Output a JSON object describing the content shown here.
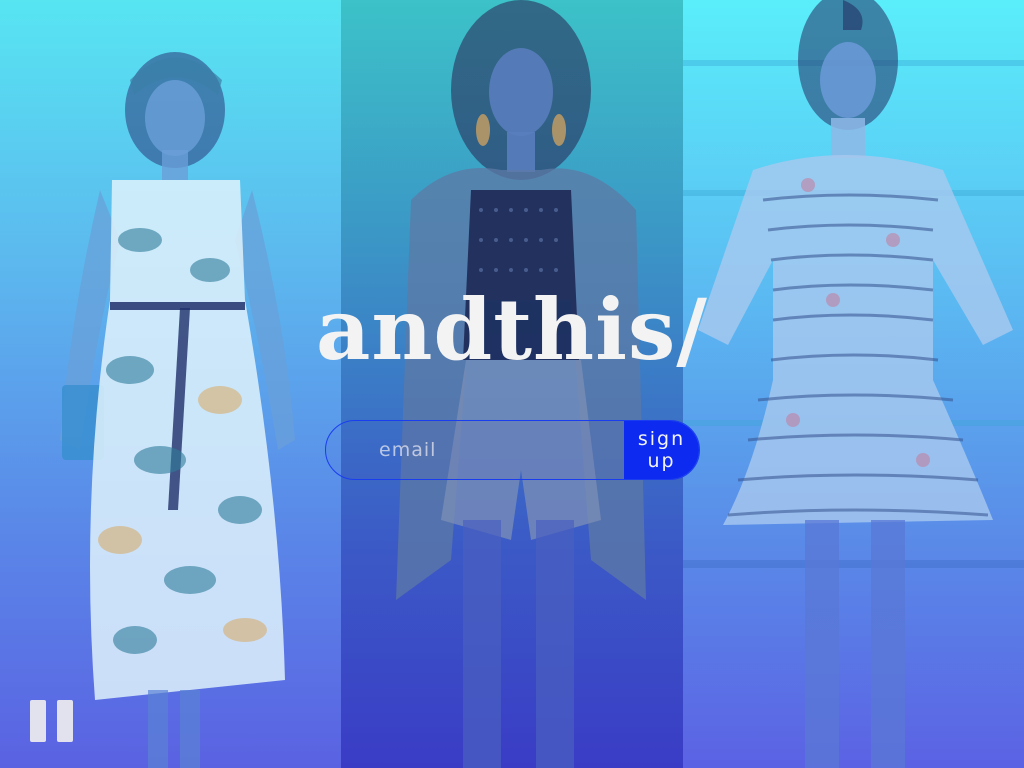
{
  "brand": {
    "logo_text": "andthis/"
  },
  "signup": {
    "email_placeholder": "email",
    "email_value": "",
    "button_label": "sign up"
  },
  "media": {
    "control_icon": "pause-icon",
    "panels": [
      {
        "subject": "model in floral print dress"
      },
      {
        "subject": "model in metallic jacket and mesh top"
      },
      {
        "subject": "model in tiered ruffle dress"
      }
    ]
  },
  "colors": {
    "accent": "#0d2bf0",
    "logo": "#f3f3f3",
    "overlay_top": "#57e5f2",
    "overlay_bottom": "#5a62e2"
  }
}
